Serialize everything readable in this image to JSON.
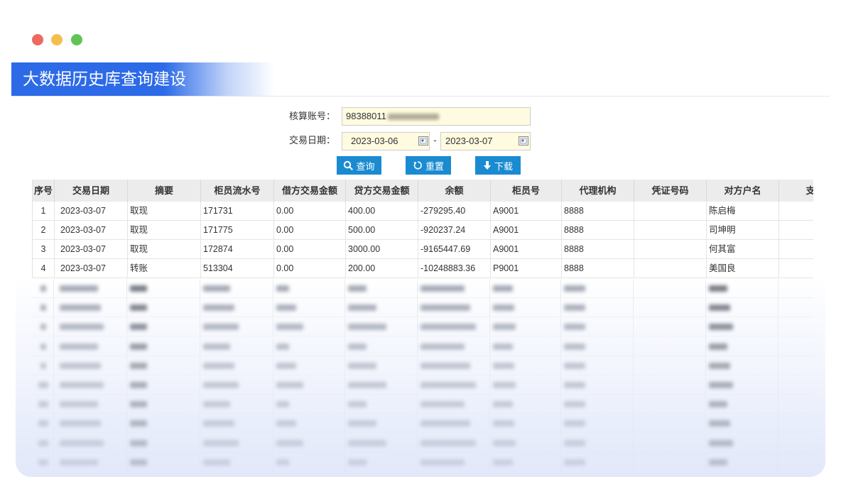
{
  "window": {
    "close_color": "#ec6a5e",
    "minimize_color": "#f4be4f",
    "maximize_color": "#61c554"
  },
  "banner": {
    "title": "大数据历史库查询建设",
    "color": "#2c6ae8"
  },
  "form": {
    "account_label": "核算账号：",
    "account_value": "98388011",
    "date_label": "交易日期：",
    "date_from": "2023-03-06",
    "date_separator": "-",
    "date_to": "2023-03-07",
    "input_bg": "#fffbe0",
    "calendar_icon": "calendar-icon"
  },
  "buttons": {
    "color": "#1a8bd1",
    "query": {
      "label": "查询",
      "icon": "search-icon"
    },
    "reset": {
      "label": "重置",
      "icon": "refresh-icon"
    },
    "download": {
      "label": "下载",
      "icon": "download-icon"
    }
  },
  "table": {
    "header_bg": "#ececec",
    "columns": [
      "序号",
      "交易日期",
      "摘要",
      "柜员流水号",
      "借方交易金额",
      "贷方交易金额",
      "余额",
      "柜员号",
      "代理机构",
      "凭证号码",
      "对方户名",
      "支票"
    ],
    "rows": [
      [
        "1",
        "2023-03-07",
        "取现",
        "171731",
        "0.00",
        "400.00",
        "-279295.40",
        "A9001",
        "8888",
        "",
        "陈启梅",
        ""
      ],
      [
        "2",
        "2023-03-07",
        "取现",
        "171775",
        "0.00",
        "500.00",
        "-920237.24",
        "A9001",
        "8888",
        "",
        "司坤明",
        ""
      ],
      [
        "3",
        "2023-03-07",
        "取现",
        "172874",
        "0.00",
        "3000.00",
        "-9165447.69",
        "A9001",
        "8888",
        "",
        "何其富",
        ""
      ],
      [
        "4",
        "2023-03-07",
        "转账",
        "513304",
        "0.00",
        "200.00",
        "-10248883.36",
        "P9001",
        "8888",
        "",
        "美国良",
        ""
      ]
    ]
  }
}
